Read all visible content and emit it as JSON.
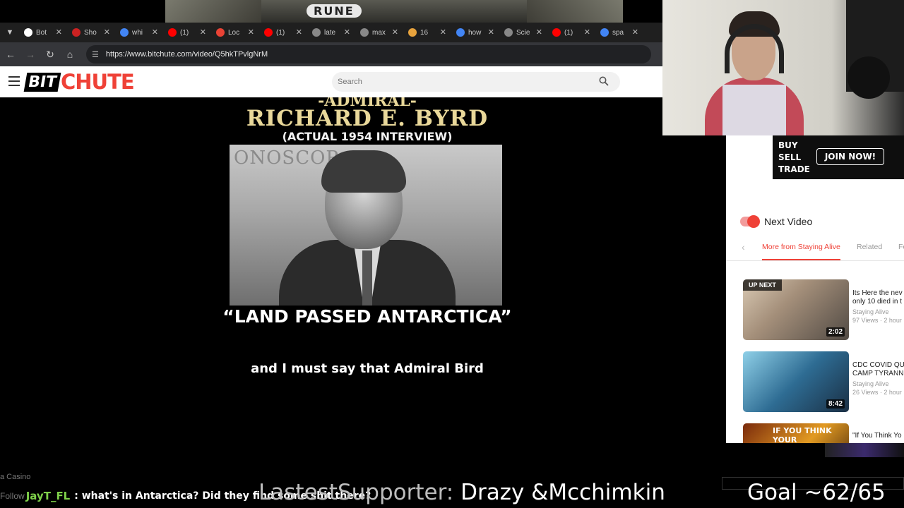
{
  "stream_banner": {
    "text": "RUNE"
  },
  "browser": {
    "tabs": [
      {
        "title": "Bot",
        "icon": "shield-icon",
        "color": "#ffffff"
      },
      {
        "title": "Sho",
        "icon": "news-icon",
        "color": "#cc2222"
      },
      {
        "title": "whi",
        "icon": "google-icon",
        "color": "#4285f4"
      },
      {
        "title": "(1) ",
        "icon": "youtube-icon",
        "color": "#ff0000"
      },
      {
        "title": "Loc",
        "icon": "puzzle-icon",
        "color": "#ea4335"
      },
      {
        "title": "(1) ",
        "icon": "youtube-icon",
        "color": "#ff0000"
      },
      {
        "title": "late",
        "icon": "globe-icon",
        "color": "#888888"
      },
      {
        "title": "max",
        "icon": "globe-icon",
        "color": "#888888"
      },
      {
        "title": "16 ",
        "icon": "bookmark-icon",
        "color": "#e8a33d"
      },
      {
        "title": "how",
        "icon": "google-icon",
        "color": "#4285f4"
      },
      {
        "title": "Scie",
        "icon": "science-icon",
        "color": "#888888"
      },
      {
        "title": "(1) ",
        "icon": "youtube-icon",
        "color": "#ff0000"
      },
      {
        "title": "spa",
        "icon": "google-icon",
        "color": "#4285f4"
      }
    ],
    "url": "https://www.bitchute.com/video/Q5hkTPvlgNrM"
  },
  "site": {
    "logo_left": "BIT",
    "logo_right": "CHUTE",
    "search_placeholder": "Search"
  },
  "video": {
    "admiral": "-ADMIRAL-",
    "name": "RICHARD E. BYRD",
    "interview": "(ACTUAL 1954 INTERVIEW)",
    "film_text": "ONOSCOP",
    "quote": "“LAND PASSED ANTARCTICA”",
    "caption": "and I must say that Admiral Bird"
  },
  "ad": {
    "lines": [
      "BUY",
      "SELL",
      "TRADE"
    ],
    "button": "JOIN NOW!"
  },
  "sidebar": {
    "next_video_label": "Next Video",
    "tabs": [
      "More from Staying Alive",
      "Related",
      "Fe"
    ],
    "videos": [
      {
        "title_l1": "Its Here the nev",
        "title_l2": "only 10 died in t",
        "channel": "Staying Alive",
        "views": "97 Views · 2 hour",
        "duration": "2:02",
        "badge": "UP NEXT"
      },
      {
        "title_l1": "CDC COVID QU",
        "title_l2": "CAMP TYRANN",
        "channel": "Staying Alive",
        "views": "26 Views · 2 hour",
        "duration": "8:42",
        "badge": ""
      },
      {
        "title_l1": "\"If You Think Yo",
        "title_l2": "",
        "channel": "",
        "views": "",
        "duration": "",
        "badge": "",
        "thumb_text": "IF YOU THINK YOUR"
      }
    ]
  },
  "overlay": {
    "casino": "a Casino",
    "ghost": "Follow",
    "chat_user": "JayT_FL",
    "chat_msg": ": what's in Antarctica? Did they find some shit there?",
    "supporter_label": "LastestSupporter:",
    "supporter_name": " Drazy &Mcchimkin",
    "goal": "Goal ~62/65"
  }
}
